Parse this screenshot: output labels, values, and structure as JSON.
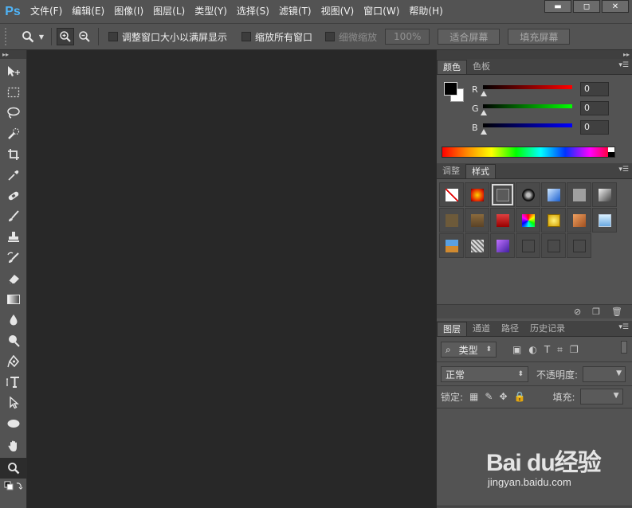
{
  "app": {
    "logo": "Ps"
  },
  "menu": [
    "文件(F)",
    "编辑(E)",
    "图像(I)",
    "图层(L)",
    "类型(Y)",
    "选择(S)",
    "滤镜(T)",
    "视图(V)",
    "窗口(W)",
    "帮助(H)"
  ],
  "window_controls": {
    "minimize": "▬",
    "restore": "◻",
    "close": "✕"
  },
  "options": {
    "resize_windows_label": "调整窗口大小以满屏显示",
    "zoom_all_label": "缩放所有窗口",
    "scrubby_zoom_label": "细微缩放",
    "zoom_value": "100%",
    "fit_screen_label": "适合屏幕",
    "fill_screen_label": "填充屏幕"
  },
  "color_panel": {
    "tabs": [
      "颜色",
      "色板"
    ],
    "active_tab": "颜色",
    "channels": [
      {
        "label": "R",
        "value": "0",
        "gradient": "#ff0000"
      },
      {
        "label": "G",
        "value": "0",
        "gradient": "#00ff00"
      },
      {
        "label": "B",
        "value": "0",
        "gradient": "#0000ff"
      }
    ],
    "foreground": "#000000",
    "background": "#ffffff"
  },
  "styles_panel": {
    "tabs": [
      "调整",
      "样式"
    ],
    "active_tab": "样式"
  },
  "layers_panel": {
    "tabs": [
      "图层",
      "通道",
      "路径",
      "历史记录"
    ],
    "active_tab": "图层",
    "filter_kind": "类型",
    "blend_mode": "正常",
    "opacity_label": "不透明度:",
    "lock_label": "锁定:",
    "fill_label": "填充:"
  },
  "watermark": {
    "brand": "Bai du经验",
    "url": "jingyan.baidu.com"
  }
}
